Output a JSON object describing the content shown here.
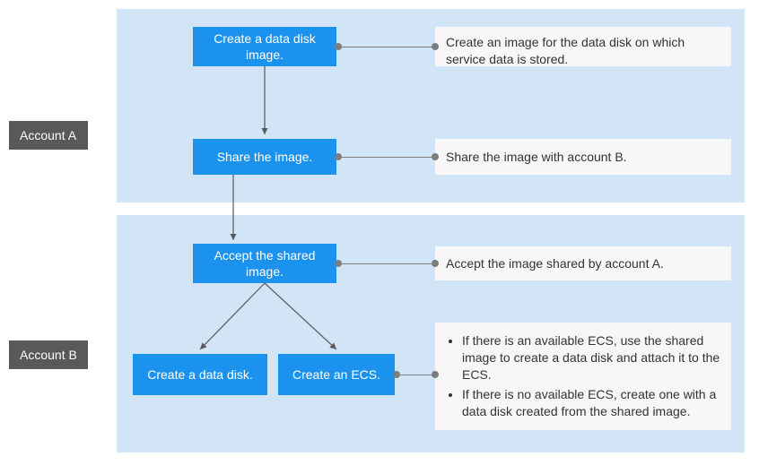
{
  "accounts": {
    "a_label": "Account A",
    "b_label": "Account  B"
  },
  "steps": {
    "create_data_disk_image": "Create a data disk image.",
    "share_image": "Share the image.",
    "accept_shared_image": "Accept the shared image.",
    "create_data_disk": "Create a data disk.",
    "create_ecs": "Create an ECS."
  },
  "descriptions": {
    "create_data_disk_image": "Create an image for the data disk on which service data is stored.",
    "share_image": "Share the image with account B.",
    "accept_shared_image": "Accept the image shared by account A.",
    "create_options_bullet1": "If there is an available ECS, use the shared image to create a data disk and attach it to the ECS.",
    "create_options_bullet2": "If there is no available ECS, create one with a data disk created from the shared image."
  }
}
